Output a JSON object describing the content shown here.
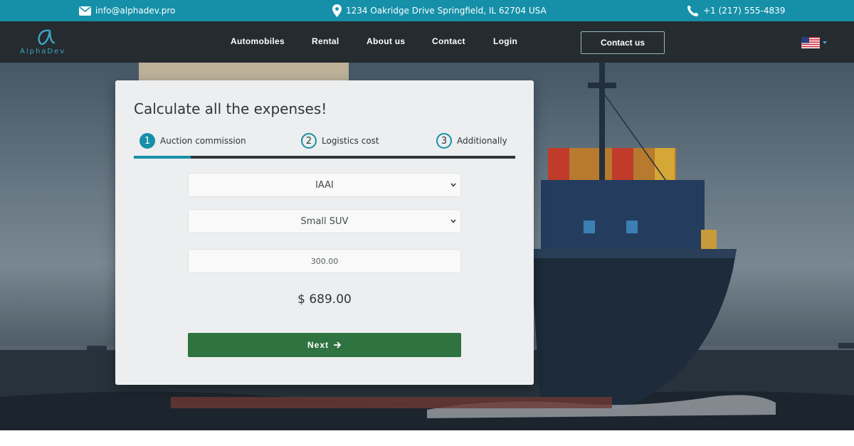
{
  "topbar": {
    "email": "info@alphadev.pro",
    "address": "1234 Oakridge Drive Springfield, IL 62704 USA",
    "phone": "+1 (217) 555-4839"
  },
  "brand": {
    "name": "AlphaDev",
    "accent": "#1590a8"
  },
  "nav": {
    "links": [
      "Automobiles",
      "Rental",
      "About us",
      "Contact",
      "Login"
    ],
    "cta": "Contact us",
    "language": "us-flag-icon"
  },
  "calculator": {
    "title": "Calculate all the expenses!",
    "steps": [
      {
        "num": "1",
        "label": "Auction commission",
        "active": true
      },
      {
        "num": "2",
        "label": "Logistics cost",
        "active": false
      },
      {
        "num": "3",
        "label": "Additionally",
        "active": false
      }
    ],
    "progress": 0.15,
    "auction_select": "IAAI",
    "vehicle_select": "Small SUV",
    "price_input": "300.00",
    "total": "$ 689.00",
    "next_label": "Next"
  },
  "colors": {
    "topbar": "#1590a8",
    "navbar": "#252b2e",
    "next_button": "#2e7340"
  }
}
